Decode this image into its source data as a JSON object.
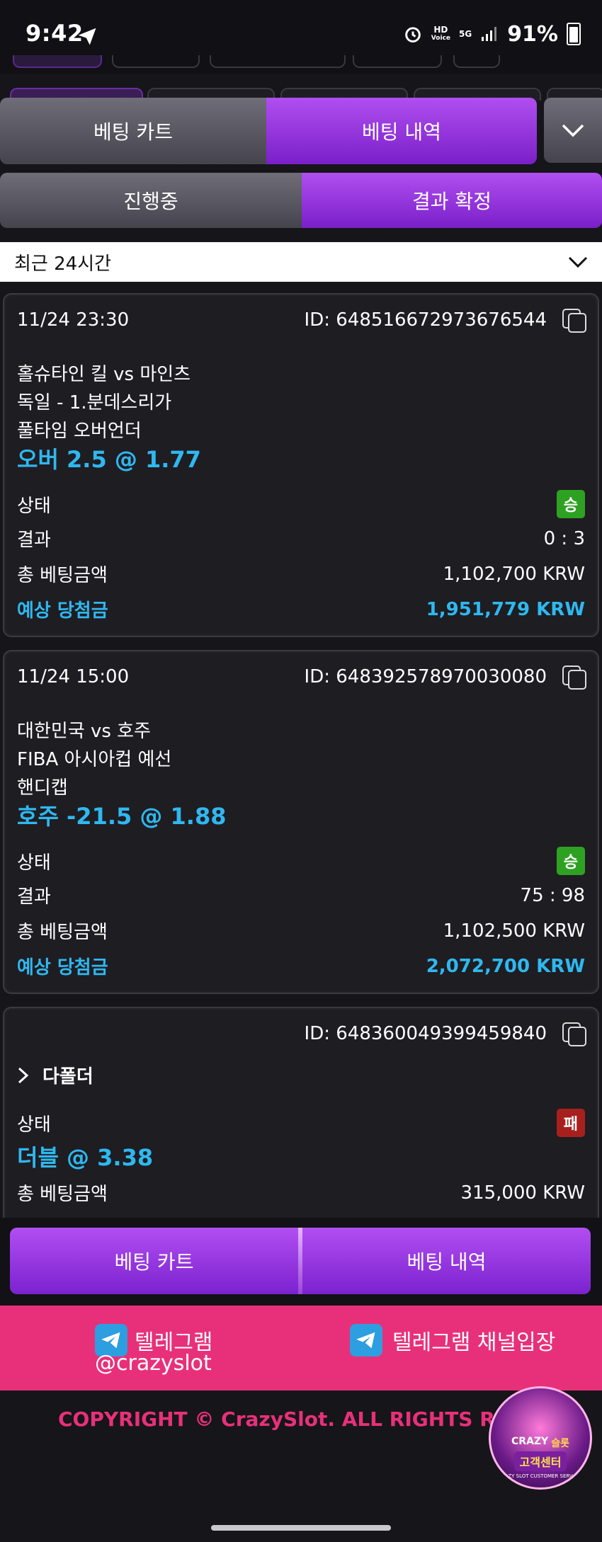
{
  "status_bar": {
    "time": "9:42",
    "battery": "91%",
    "hd_label": "HD",
    "voice_label": "Voice",
    "network": "5G"
  },
  "tabs_top": {
    "cart": "베팅 카트",
    "history": "베팅 내역"
  },
  "tabs_sub": {
    "in_progress": "진행중",
    "confirmed": "결과 확정"
  },
  "filter": {
    "selected": "최근 24시간"
  },
  "labels": {
    "status": "상태",
    "result": "결과",
    "total_bet": "총 베팅금액",
    "expected_win": "예상 당첨금"
  },
  "bets": [
    {
      "datetime": "11/24 23:30",
      "id": "ID: 648516672973676544",
      "match": "홀슈타인 킬 vs 마인츠",
      "league": "독일 - 1.분데스리가",
      "market": "풀타임 오버언더",
      "pick": "오버 2.5 @ 1.77",
      "status": "승",
      "result": "0 : 3",
      "total_bet": "1,102,700 KRW",
      "expected_win": "1,951,779 KRW"
    },
    {
      "datetime": "11/24 15:00",
      "id": "ID: 648392578970030080",
      "match": "대한민국 vs 호주",
      "league": "FIBA 아시아컵 예선",
      "market": "핸디캡",
      "pick": "호주 -21.5 @ 1.88",
      "status": "승",
      "result": "75 : 98",
      "total_bet": "1,102,500 KRW",
      "expected_win": "2,072,700 KRW"
    },
    {
      "id": "ID: 648360049399459840",
      "type": "다폴더",
      "status": "패",
      "pick": "더블 @ 3.38",
      "total_bet": "315,000 KRW"
    }
  ],
  "bottom_nav": {
    "cart": "베팅 카트",
    "history": "베팅 내역"
  },
  "footer": {
    "telegram_label": "텔레그램",
    "telegram_handle": "@crazyslot",
    "telegram_channel": "텔레그램 채널입장",
    "copyright": "COPYRIGHT © CrazySlot. ALL RIGHTS RESE",
    "cs_logo_brand": "CRAZY",
    "cs_logo_brand_kr": "슬롯",
    "cs_logo_label": "고객센터",
    "cs_logo_sub": "ZY SLOT CUSTOMER SERV"
  },
  "colors": {
    "accent_purple": "#9b3ee3",
    "accent_blue": "#2fb8f0",
    "pink": "#e8307a",
    "win_green": "#2ea123",
    "lose_red": "#a8201e"
  }
}
